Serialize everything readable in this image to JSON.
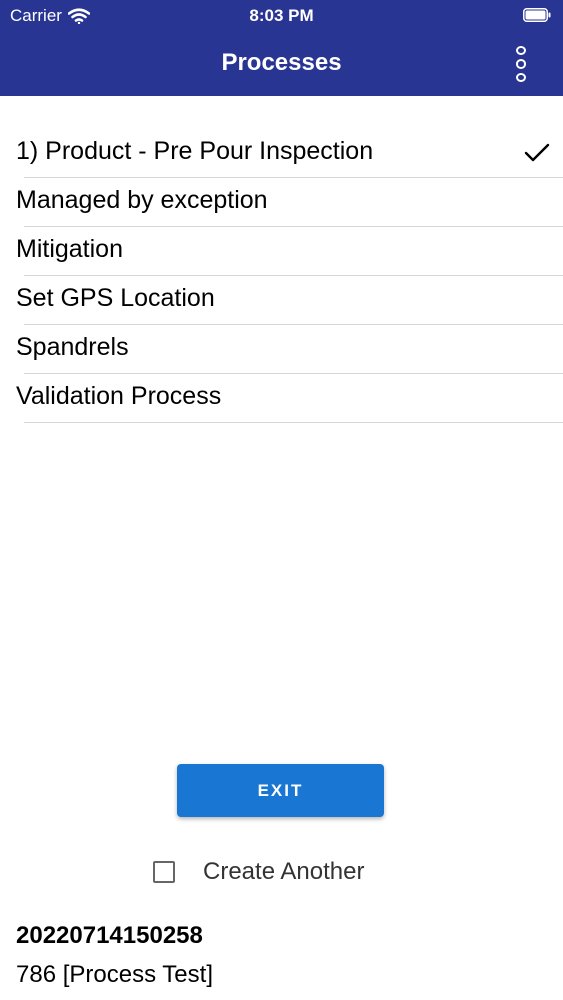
{
  "status_bar": {
    "carrier": "Carrier",
    "time": "8:03 PM"
  },
  "header": {
    "title": "Processes",
    "background_color": "#283593",
    "menu_icon": "more-vertical-icon"
  },
  "processes": [
    {
      "label": "1) Product - Pre Pour Inspection",
      "selected": true
    },
    {
      "label": "Managed by exception",
      "selected": false
    },
    {
      "label": "Mitigation",
      "selected": false
    },
    {
      "label": "Set GPS Location",
      "selected": false
    },
    {
      "label": "Spandrels",
      "selected": false
    },
    {
      "label": "Validation Process",
      "selected": false
    }
  ],
  "actions": {
    "exit_label": "EXIT",
    "exit_color": "#1976d2"
  },
  "create_another": {
    "label": "Create Another",
    "checked": false
  },
  "record": {
    "id": "20220714150258",
    "name": "786 [Process Test]"
  }
}
